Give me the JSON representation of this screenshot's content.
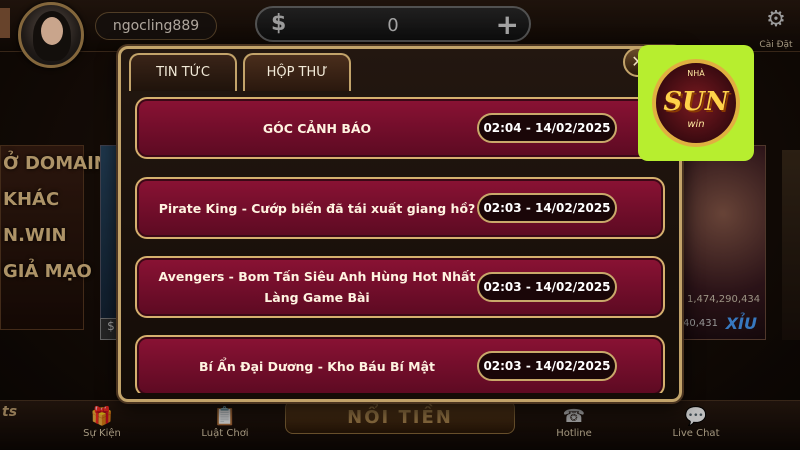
{
  "header": {
    "username": "ngocling889",
    "balance": "0",
    "currency_symbol": "$",
    "add_symbol": "+",
    "settings_label": "Cài Đặt"
  },
  "background": {
    "promo_lines": [
      "Ở DOMAIN",
      "KHÁC",
      "N.WIN",
      "GIẢ MẠO"
    ],
    "jackpot_value": "1,474,290,434",
    "bet_value": "40,431",
    "xiu_label": "XỈU",
    "center_button": "NỔI TIỀN",
    "stars_text": "ts"
  },
  "bottom_nav": [
    {
      "label": "Sự Kiện",
      "icon": "gift-icon"
    },
    {
      "label": "Luật Chơi",
      "icon": "rules-icon"
    },
    {
      "label": "Hotline",
      "icon": "phone-icon"
    },
    {
      "label": "Live Chat",
      "icon": "chat-icon"
    }
  ],
  "modal": {
    "tabs": [
      {
        "label": "TIN TỨC",
        "active": false
      },
      {
        "label": "HỘP THƯ",
        "active": true
      }
    ],
    "messages": [
      {
        "title": "GÓC CẢNH BÁO",
        "time": "02:04 - 14/02/2025"
      },
      {
        "title": "Pirate King - Cướp biển đã tái xuất giang hồ?",
        "time": "02:03 - 14/02/2025"
      },
      {
        "title": "Avengers - Bom Tấn Siêu Anh Hùng Hot Nhất Làng Game Bài",
        "time": "02:03 - 14/02/2025"
      },
      {
        "title": "Bí Ẩn Đại Dương - Kho Báu Bí Mật",
        "time": "02:03 - 14/02/2025"
      }
    ]
  },
  "logo": {
    "main": "SUN",
    "sub": "win",
    "top": "NHÀ"
  },
  "colors": {
    "accent_gold": "#c2a36a",
    "message_red": "#8a1234",
    "logo_bg": "#b7ee2f"
  }
}
